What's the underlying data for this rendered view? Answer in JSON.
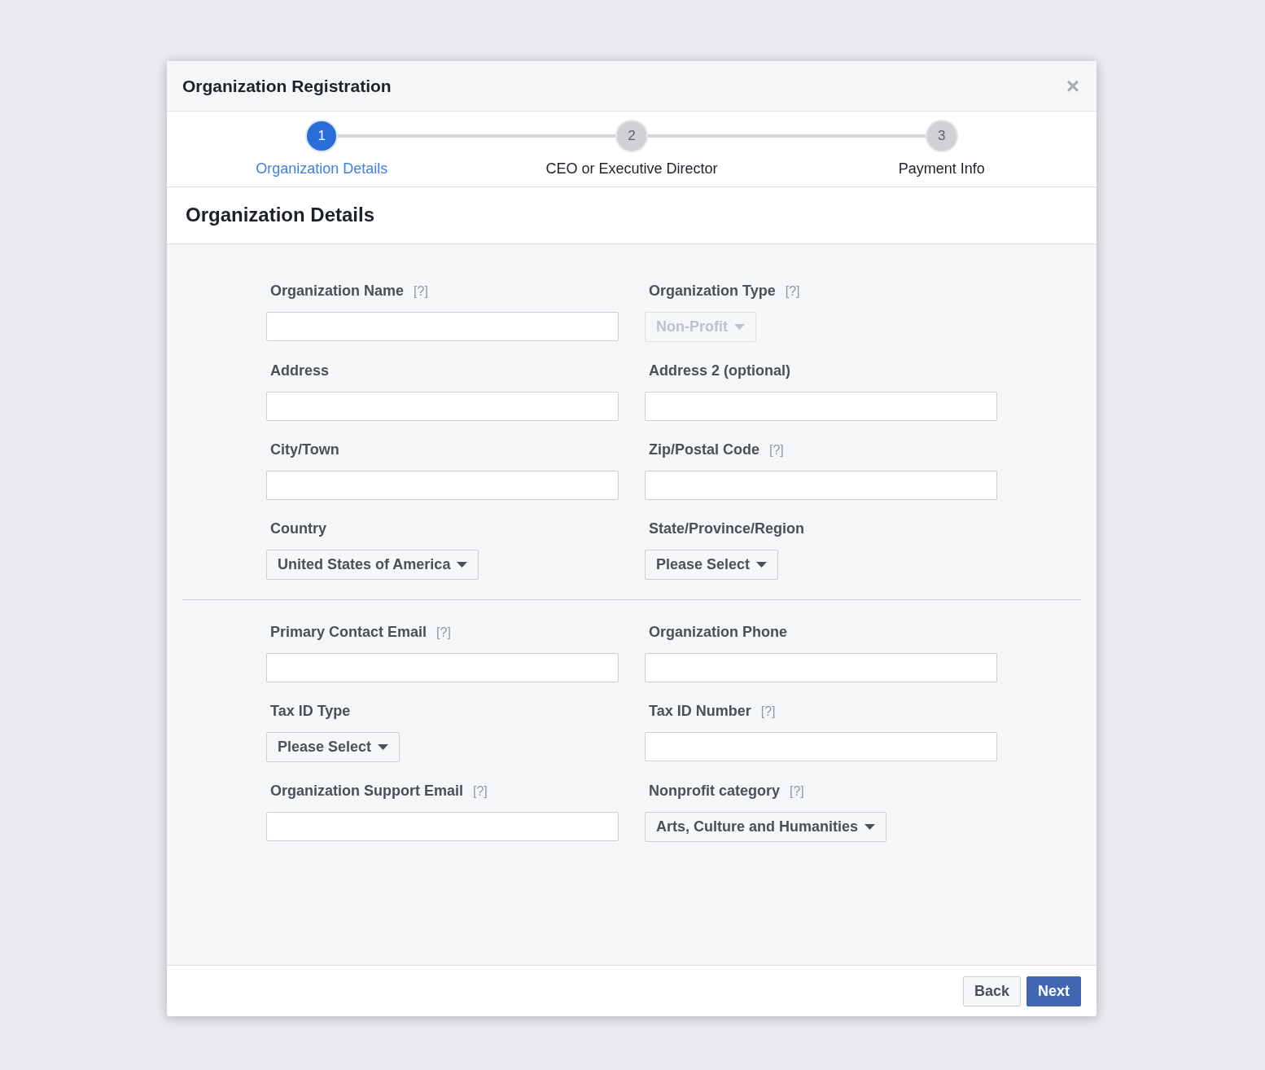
{
  "dialog": {
    "title": "Organization Registration",
    "close": "×"
  },
  "steps": [
    {
      "number": "1",
      "label": "Organization Details",
      "selected": true
    },
    {
      "number": "2",
      "label": "CEO or Executive Director",
      "selected": false
    },
    {
      "number": "3",
      "label": "Payment Info",
      "selected": false
    }
  ],
  "section_title": "Organization Details",
  "sections": [
    {
      "fields": [
        {
          "label": "Organization Name",
          "help": "[?]",
          "kind": "text"
        },
        {
          "label": "Organization Type",
          "help": "[?]",
          "kind": "select",
          "value": "Non-Profit",
          "disabled": true
        },
        {
          "label": "Address",
          "kind": "text"
        },
        {
          "label": "Address 2 (optional)",
          "kind": "text"
        },
        {
          "label": "City/Town",
          "kind": "text"
        },
        {
          "label": "Zip/Postal Code",
          "help": "[?]",
          "kind": "text"
        },
        {
          "label": "Country",
          "kind": "select",
          "value": "United States of America",
          "disabled": false
        },
        {
          "label": "State/Province/Region",
          "kind": "select",
          "value": "Please Select",
          "disabled": false
        }
      ]
    },
    {
      "fields": [
        {
          "label": "Primary Contact Email",
          "help": "[?]",
          "kind": "text"
        },
        {
          "label": "Organization Phone",
          "kind": "text"
        },
        {
          "label": "Tax ID Type",
          "kind": "select",
          "value": "Please Select",
          "disabled": false
        },
        {
          "label": "Tax ID Number",
          "help": "[?]",
          "kind": "text"
        },
        {
          "label": "Organization Support Email",
          "help": "[?]",
          "kind": "text"
        },
        {
          "label": "Nonprofit category",
          "help": "[?]",
          "kind": "select",
          "value": "Arts, Culture and Humanities",
          "disabled": false
        }
      ]
    }
  ],
  "buttons": [
    {
      "label": "Back",
      "primary": false
    },
    {
      "label": "Next",
      "primary": true
    }
  ]
}
